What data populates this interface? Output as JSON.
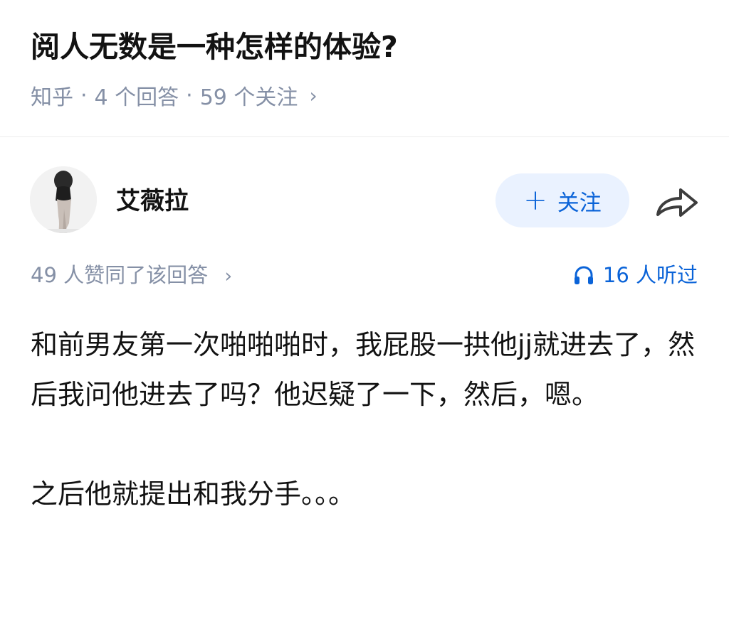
{
  "question": {
    "title": "阅人无数是一种怎样的体验?",
    "source": "知乎",
    "separator": "·",
    "answers": "4 个回答",
    "followers": "59 个关注",
    "chevron": "›"
  },
  "answer": {
    "author_name": "艾薇拉",
    "follow_plus": "+",
    "follow_label": "关注",
    "approvals": "49 人赞同了该回答",
    "approvals_chevron": "›",
    "listens": "16 人听过",
    "paragraph1": "和前男友第一次啪啪啪时，我屁股一拱他jj就进去了，然后我问他进去了吗？他迟疑了一下，然后，嗯。",
    "paragraph2": "之后他就提出和我分手。。。"
  },
  "icons": {
    "share": "share-icon",
    "headphones": "headphones-icon",
    "avatar": "avatar-photo"
  },
  "colors": {
    "accent": "#0a63d8",
    "accent_bg": "#eaf2ff",
    "meta_gray": "#8590a6",
    "text": "#121212"
  }
}
